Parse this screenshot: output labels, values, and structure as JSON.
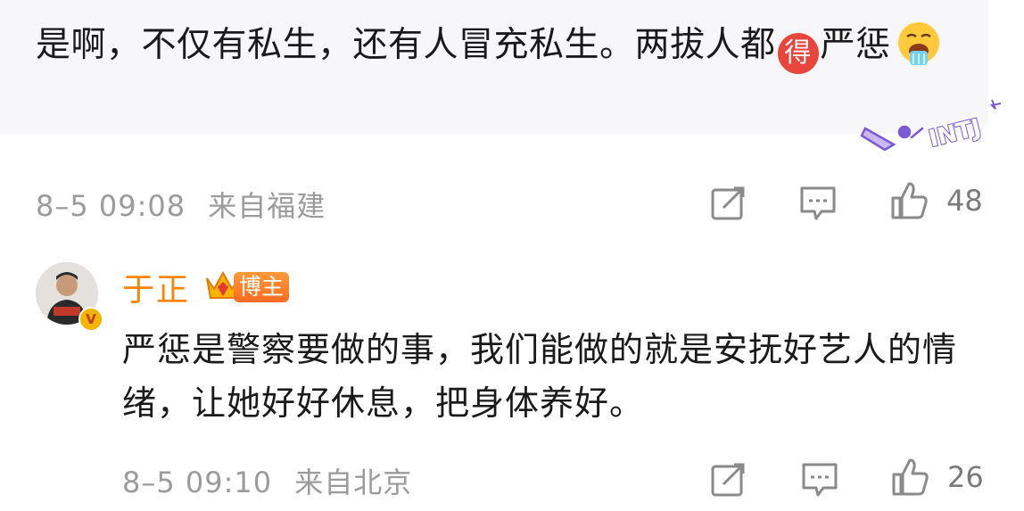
{
  "comment": {
    "text_1": "是啊，不仅有私生，还有人冒充私生。两拔人都",
    "badge": "得",
    "text_2": "严惩",
    "emoji": "drooling-face-emoji",
    "sticker": "INTJ",
    "time": "8–5 09:08",
    "location": "来自福建",
    "likes": "48"
  },
  "reply": {
    "username": "于正",
    "tag": "博主",
    "text": "严惩是警察要做的事，我们能做的就是安抚好艺人的情绪，让她好好休息，把身体养好。",
    "time": "8–5 09:10",
    "location": "来自北京",
    "likes": "26"
  },
  "icons": [
    "share-icon",
    "comment-icon",
    "like-icon",
    "crown-icon",
    "verified-badge-icon"
  ]
}
